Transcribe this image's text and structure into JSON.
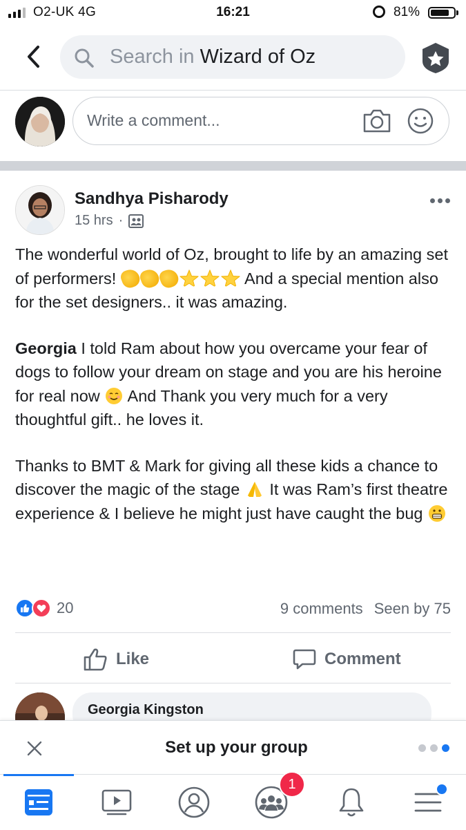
{
  "status_bar": {
    "carrier": "O2-UK  4G",
    "time": "16:21",
    "battery_pct": "81%",
    "battery_level": 0.81
  },
  "header": {
    "search_prefix": "Search in ",
    "search_group": "Wizard of Oz"
  },
  "composer": {
    "placeholder": "Write a comment..."
  },
  "post": {
    "author": "Sandhya Pisharody",
    "time": "15 hrs",
    "paragraph1_a": "The wonderful world of Oz, brought to life by an amazing set of performers!",
    "paragraph1_b": "And a special mention also for the set designers.. it was amazing.",
    "mention": "Georgia",
    "paragraph2_a": " I told Ram about how you overcame your fear of dogs to follow your dream on stage and you are his heroine for real now ",
    "paragraph2_b": " And Thank you very much for a very thoughtful gift.. he loves it.",
    "paragraph3_a": "Thanks to BMT & Mark for giving all these kids a chance to discover the magic of the stage ",
    "paragraph3_b": " It was Ram’s first theatre experience & I believe he might just have caught the bug ",
    "reaction_count": "20",
    "comments": "9 comments",
    "seen": "Seen by 75",
    "like_label": "Like",
    "comment_label": "Comment"
  },
  "comment_preview": {
    "name": "Georgia Kingston"
  },
  "setup_banner": {
    "title": "Set up your group"
  },
  "tabbar": {
    "notification_count": "1"
  },
  "colors": {
    "accent": "#1877f2",
    "love": "#f33e58",
    "badge": "#f02849"
  }
}
